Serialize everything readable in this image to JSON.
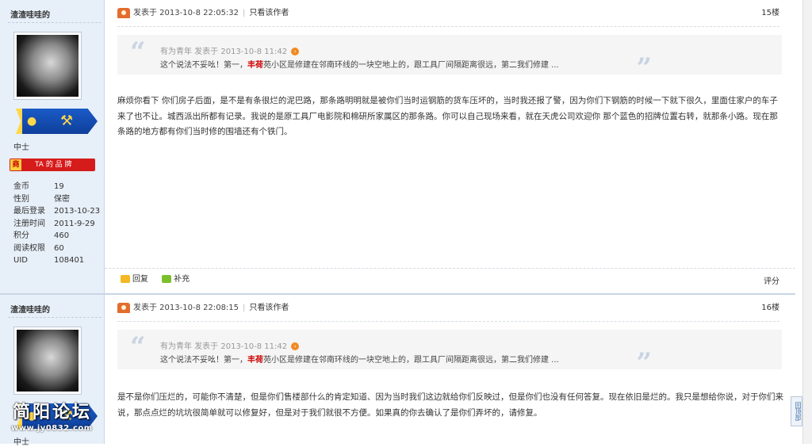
{
  "posts": [
    {
      "username": "渣渣哇哇的",
      "rank": "中士",
      "brand_label": "TA 的 品 牌",
      "stats": [
        {
          "k": "金币",
          "v": "19"
        },
        {
          "k": "性别",
          "v": "保密"
        },
        {
          "k": "最后登录",
          "v": "2013-10-23"
        },
        {
          "k": "注册时间",
          "v": "2011-9-29"
        },
        {
          "k": "积分",
          "v": "460"
        },
        {
          "k": "阅读权限",
          "v": "60"
        },
        {
          "k": "UID",
          "v": "108401"
        }
      ],
      "posted": "发表于 2013-10-8 22:05:32",
      "only_author": "只看该作者",
      "floor": "15楼",
      "quote_meta": "有为青年 发表于 2013-10-8 11:42",
      "quote_pre": "这个说法不妥吆！第一，",
      "quote_bold": "丰荷",
      "quote_post": "苑小区是修建在邻南环线的一块空地上的，跟工具厂间隔距离很远，第二我们修建 ...",
      "content": "麻烦你看下 你们房子后面，是不是有条很烂的泥巴路，那条路明明就是被你们当时运钢筋的货车压坏的，当时我还报了警，因为你们下钢筋的时候一下就下很久，里面住家户的车子来了也不让。城西派出所都有记录。我说的是原工具厂电影院和棉研所家属区的那条路。你可以自己现场来看，就在天虎公司欢迎你 那个蓝色的招牌位置右转，就那条小路。现在那条路的地方都有你们当时修的围墙还有个铁门。",
      "reply": "回复",
      "add": "补充",
      "rate": "评分"
    },
    {
      "username": "渣渣哇哇的",
      "rank": "中士",
      "posted": "发表于 2013-10-8 22:08:15",
      "only_author": "只看该作者",
      "floor": "16楼",
      "quote_meta": "有为青年 发表于 2013-10-8 11:42",
      "quote_pre": "这个说法不妥吆！第一，",
      "quote_bold": "丰荷",
      "quote_post": "苑小区是修建在邻南环线的一块空地上的，跟工具厂间隔距离很远，第二我们修建 ...",
      "content": "是不是你们压烂的，可能你不清楚，但是你们售楼部什么的肯定知道、因为当时我们这边就给你们反映过，但是你们也没有任何答复。现在依旧是烂的。我只是想给你说，对于你们来说，那点点烂的坑坑很简单就可以修复好，但是对于我们就很不方便。如果真的你去确认了是你们弄坏的，请修复。"
    }
  ],
  "scroll_top": "回顶部",
  "watermark": "简阳论坛",
  "watermark_url": "www.jy0832.com"
}
